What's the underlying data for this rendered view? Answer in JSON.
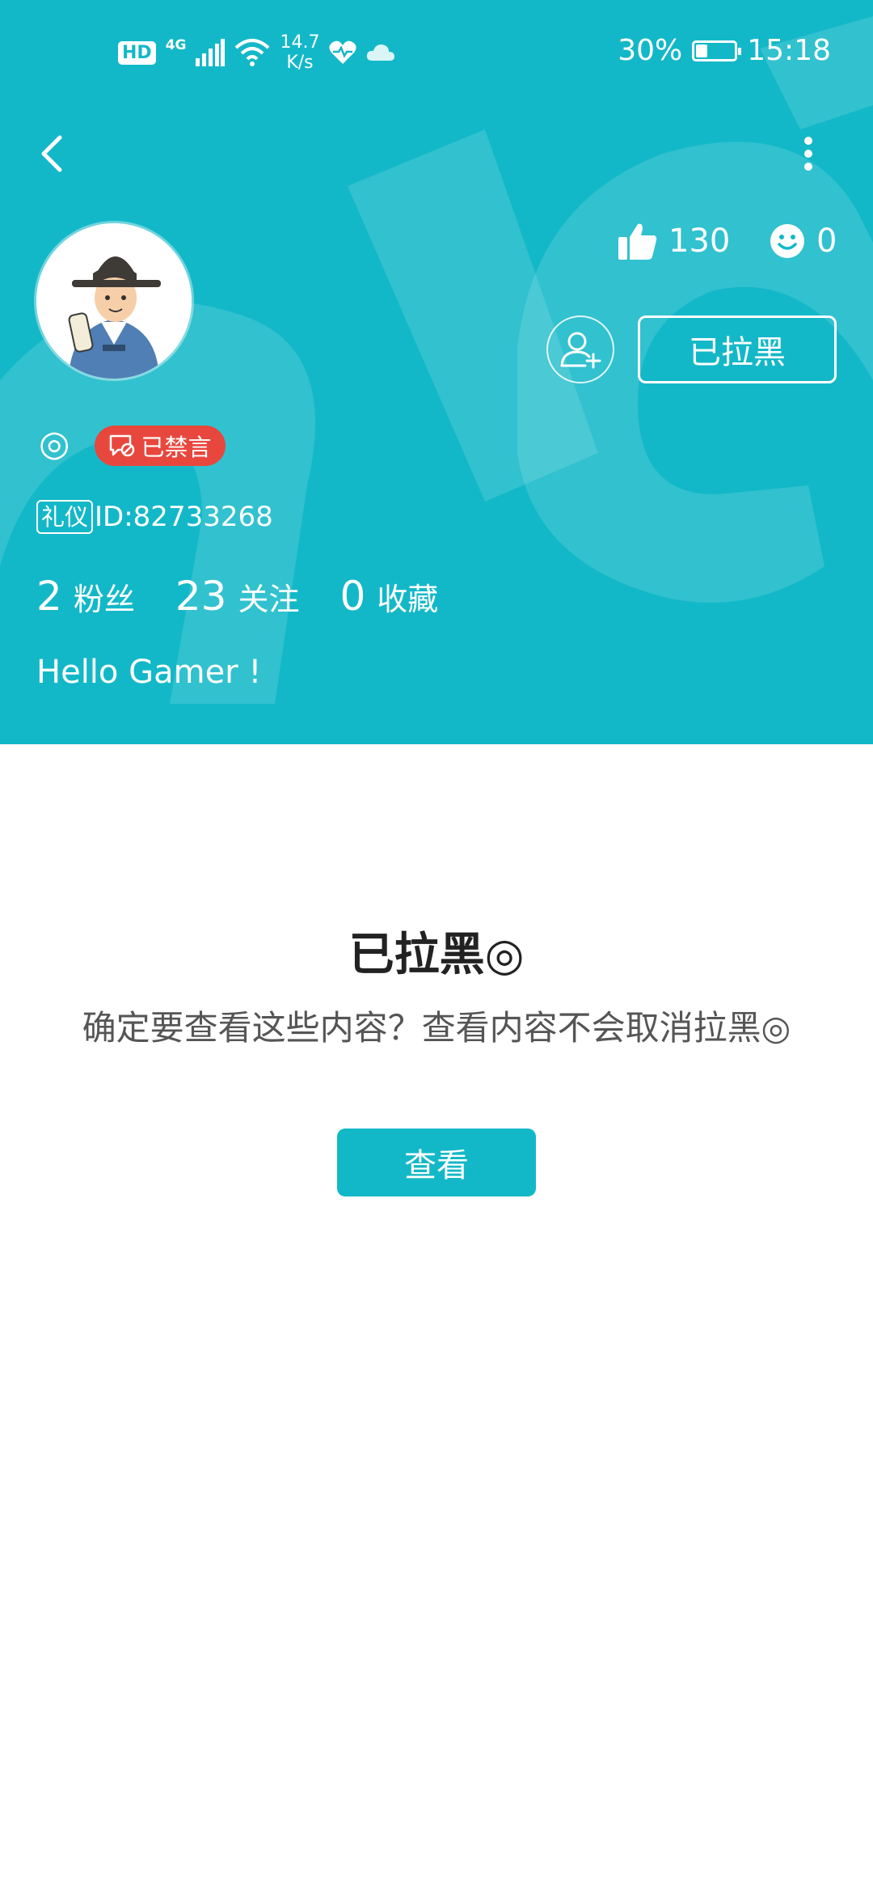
{
  "status_bar": {
    "hd": "HD",
    "network": "4G",
    "speed_value": "14.7",
    "speed_unit": "K/s",
    "battery_percent": "30%",
    "battery_level": 0.3,
    "time": "15:18"
  },
  "profile": {
    "likes_count": "130",
    "smile_count": "0",
    "blocked_button_label": "已拉黑",
    "ring_glyph": "◎",
    "muted_badge_label": "已禁言",
    "etiquette_tag": "礼仪",
    "id_text": "ID:82733268",
    "stats": [
      {
        "value": "2",
        "label": "粉丝"
      },
      {
        "value": "23",
        "label": "关注"
      },
      {
        "value": "0",
        "label": "收藏"
      }
    ],
    "bio": "Hello Gamer !"
  },
  "blocked_notice": {
    "title": "已拉黑◎",
    "message": "确定要查看这些内容？查看内容不会取消拉黑◎",
    "view_button_label": "查看"
  },
  "colors": {
    "header_bg": "#13b8c8",
    "badge_red": "#e8473d",
    "primary_button": "#13b8c8"
  },
  "icons": [
    "back-arrow-icon",
    "more-vertical-icon",
    "thumbs-up-icon",
    "smile-face-icon",
    "add-friend-icon",
    "muted-chat-icon",
    "signal-icon",
    "wifi-icon",
    "heart-monitor-icon",
    "cloud-icon",
    "battery-icon"
  ]
}
